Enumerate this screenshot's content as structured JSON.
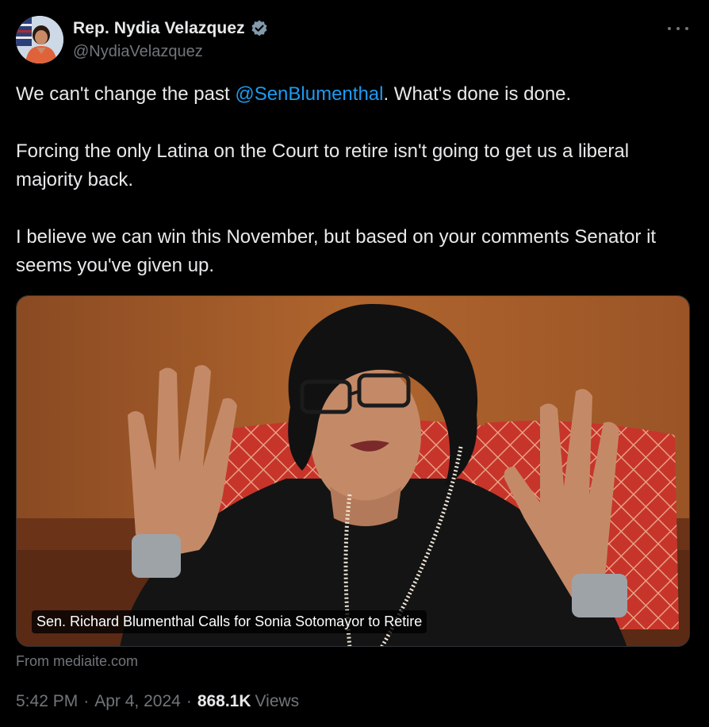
{
  "author": {
    "display_name": "Rep. Nydia Velazquez",
    "handle": "@NydiaVelazquez",
    "verified_icon": "verified-badge-icon",
    "badge_color": "#829aab"
  },
  "tweet": {
    "line1_pre": "We can't change the past ",
    "mention": "@SenBlumenthal",
    "line1_post": ". What's done is done.",
    "para2": "Forcing the only Latina on the Court to retire isn't going to get us a liberal majority back.",
    "para3": "I believe we can win this November, but based on your comments Senator it seems you've given up."
  },
  "card": {
    "caption": "Sen. Richard Blumenthal Calls for Sonia Sotomayor to Retire",
    "source": "From mediaite.com"
  },
  "meta": {
    "time": "5:42 PM",
    "date": "Apr 4, 2024",
    "separator": "·",
    "views_count": "868.1K",
    "views_label": "Views"
  },
  "colors": {
    "background": "#000000",
    "text": "#e7e9ea",
    "secondary": "#71767b",
    "link": "#1d9bf0"
  }
}
